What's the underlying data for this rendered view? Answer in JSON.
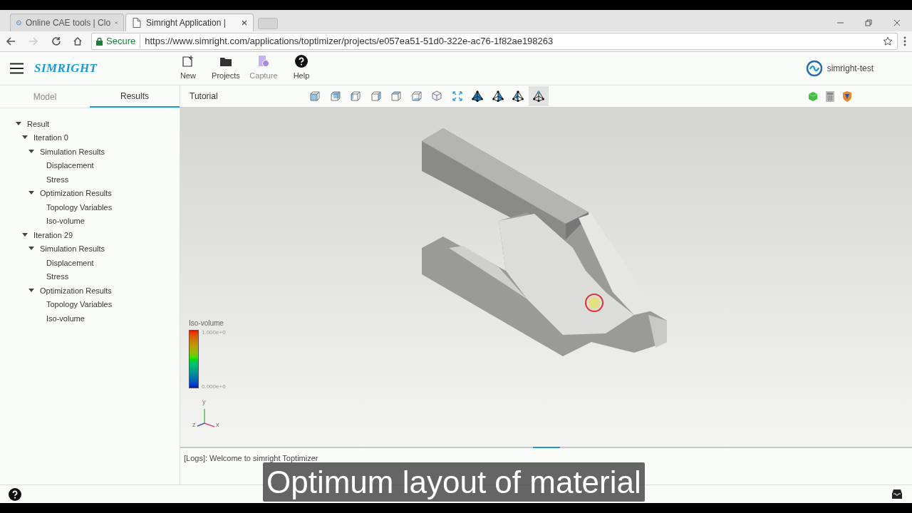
{
  "browser": {
    "tabs": [
      {
        "title": "Online CAE tools | Clo",
        "selected": false,
        "kind": "logo"
      },
      {
        "title": "Simright Application |",
        "selected": true,
        "kind": "page"
      }
    ],
    "secure_label": "Secure",
    "url": "https://www.simright.com/applications/toptimizer/projects/e057ea51-51d0-322e-ac76-1f82ae198263"
  },
  "app": {
    "logo": "SIMRIGHT",
    "menu": [
      {
        "label": "New",
        "kind": "new",
        "disabled": false
      },
      {
        "label": "Projects",
        "kind": "folder",
        "disabled": false
      },
      {
        "label": "Capture",
        "kind": "capture",
        "disabled": true
      },
      {
        "label": "Help",
        "kind": "help",
        "disabled": false
      }
    ],
    "user": "simright-test"
  },
  "sidebar": {
    "tabs": [
      {
        "label": "Model",
        "selected": false
      },
      {
        "label": "Results",
        "selected": true
      }
    ],
    "tree": [
      {
        "label": "Result",
        "expanded": true,
        "children": [
          {
            "label": "Iteration 0",
            "expanded": true,
            "children": [
              {
                "label": "Simulation Results",
                "expanded": true,
                "children": [
                  {
                    "label": "Displacement"
                  },
                  {
                    "label": "Stress"
                  }
                ]
              },
              {
                "label": "Optimization Results",
                "expanded": true,
                "children": [
                  {
                    "label": "Topology Variables"
                  },
                  {
                    "label": "Iso-volume"
                  }
                ]
              }
            ]
          },
          {
            "label": "Iteration 29",
            "expanded": true,
            "children": [
              {
                "label": "Simulation Results",
                "expanded": true,
                "children": [
                  {
                    "label": "Displacement"
                  },
                  {
                    "label": "Stress"
                  }
                ]
              },
              {
                "label": "Optimization Results",
                "expanded": true,
                "children": [
                  {
                    "label": "Topology Variables"
                  },
                  {
                    "label": "Iso-volume"
                  }
                ]
              }
            ]
          }
        ]
      }
    ]
  },
  "viewer": {
    "title": "Tutorial",
    "tools": [
      {
        "kind": "cube-front",
        "selected": false
      },
      {
        "kind": "cube-back",
        "selected": false
      },
      {
        "kind": "cube-left",
        "selected": false
      },
      {
        "kind": "cube-right",
        "selected": false
      },
      {
        "kind": "cube-top",
        "selected": false
      },
      {
        "kind": "cube-bottom",
        "selected": false
      },
      {
        "kind": "cube-iso",
        "selected": false
      },
      {
        "kind": "fit",
        "selected": false
      },
      {
        "kind": "tetra-solid",
        "selected": false
      },
      {
        "kind": "tetra-shaded",
        "selected": false
      },
      {
        "kind": "tetra-wire",
        "selected": false
      },
      {
        "kind": "tetra-points",
        "selected": true
      }
    ],
    "right_tools": [
      {
        "kind": "green-cube"
      },
      {
        "kind": "calculator"
      },
      {
        "kind": "shield"
      }
    ],
    "legend": {
      "title": "Iso-volume",
      "max": "1.000e+0",
      "min": "0.000e+0"
    },
    "axes": {
      "x": "x",
      "y": "y",
      "z": "z"
    }
  },
  "logs": "[Logs]: Welcome to simright Toptimizer",
  "caption": "Optimum layout of material"
}
